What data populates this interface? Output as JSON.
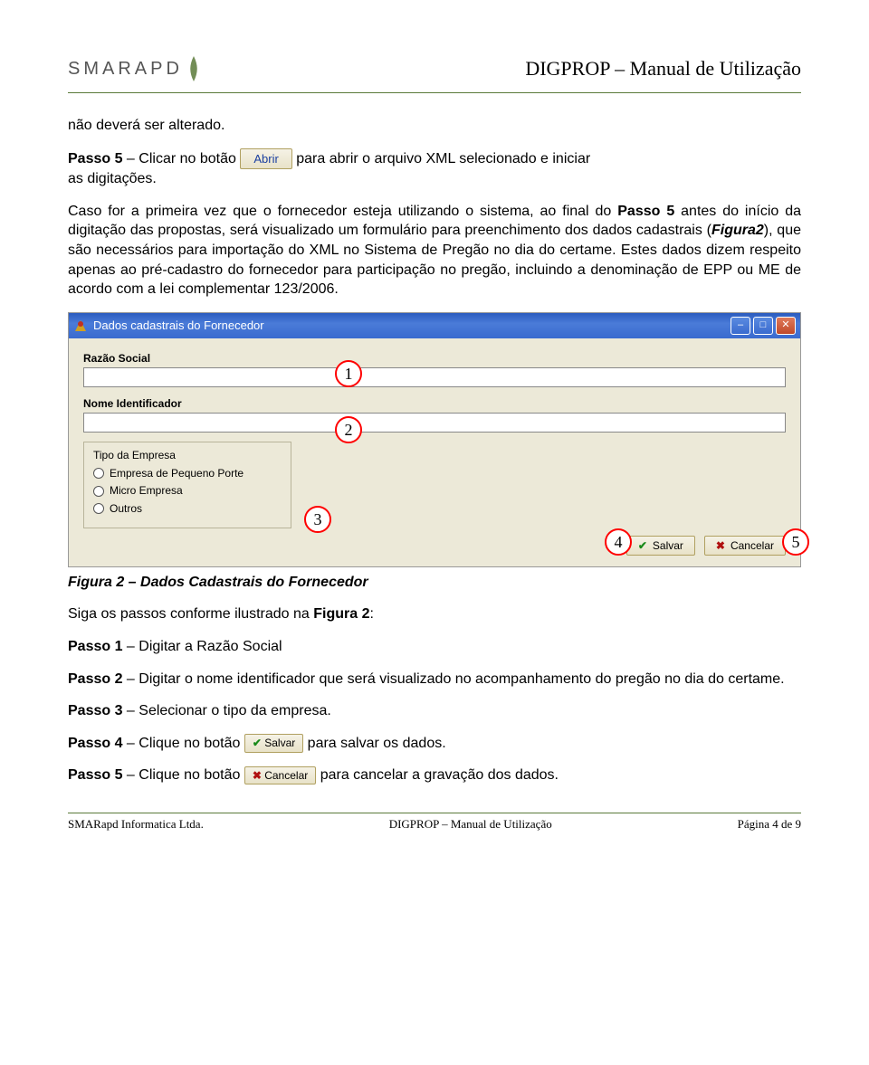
{
  "header": {
    "logo_text": "SMARAPD",
    "doc_title": "DIGPROP – Manual de Utilização"
  },
  "text": {
    "t1": "não deverá ser alterado.",
    "passo5_a": "Passo 5",
    "passo5_b": " – Clicar no botão ",
    "abrir_btn": "Abrir",
    "passo5_c": " para abrir o arquivo XML selecionado e iniciar",
    "passo5_d": "as digitações.",
    "p2": "Caso for a primeira vez que o fornecedor esteja utilizando o sistema, ao final do ",
    "p2b": "Passo 5",
    "p2c": " antes do início da digitação das propostas, será visualizado um formulário para preenchimento dos dados cadastrais (",
    "p2d": "Figura2",
    "p2e": "), que são necessários para importação do XML no Sistema de Pregão no dia do certame. Estes dados dizem respeito apenas ao pré-cadastro do fornecedor para participação no pregão, incluindo a denominação de EPP ou ME de acordo com a lei complementar 123/2006.",
    "caption": "Figura 2 – Dados Cadastrais do Fornecedor",
    "siga": "Siga os passos conforme ilustrado na ",
    "fig2": "Figura 2",
    "colon": ":",
    "p_1a": "Passo 1",
    "p_1b": " – Digitar a Razão Social",
    "p_2a": "Passo 2",
    "p_2b": " – Digitar o nome identificador que será visualizado no acompanhamento do pregão no dia do certame.",
    "p_3a": "Passo 3",
    "p_3b": " – Selecionar o tipo da empresa.",
    "p_4a": "Passo 4",
    "p_4b": " – Clique no botão ",
    "salvar_btn": "Salvar",
    "p_4c": " para salvar os dados.",
    "p_5a": "Passo 5",
    "p_5b": " – Clique no botão ",
    "cancelar_btn": "Cancelar",
    "p_5c": " para cancelar a gravação dos dados."
  },
  "screenshot": {
    "title": "Dados cadastrais do Fornecedor",
    "lbl_razao": "Razão Social",
    "lbl_nome": "Nome Identificador",
    "group_title": "Tipo da Empresa",
    "opt1": "Empresa de Pequeno Porte",
    "opt2": "Micro Empresa",
    "opt3": "Outros",
    "btn_salvar": "Salvar",
    "btn_cancelar": "Cancelar",
    "callouts": {
      "c1": "1",
      "c2": "2",
      "c3": "3",
      "c4": "4",
      "c5": "5"
    }
  },
  "footer": {
    "left": "SMARapd Informatica Ltda.",
    "center": "DIGPROP – Manual de Utilização",
    "right": "Página 4 de 9"
  }
}
